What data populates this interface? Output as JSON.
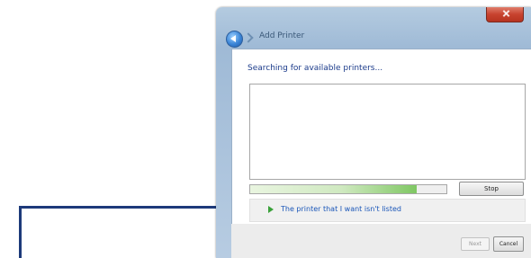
{
  "window": {
    "title": "Add Printer"
  },
  "content": {
    "heading": "Searching for available printers...",
    "progress": 0.85,
    "stop_label": "Stop",
    "not_listed_link": "The printer that I want isn't listed"
  },
  "footer": {
    "next_label": "Next",
    "cancel_label": "Cancel"
  },
  "colors": {
    "callout_arrow": "#1d3a7a",
    "heading_text": "#1a3a8a",
    "link_text": "#1a56b8",
    "progress_green": "#7fc763"
  },
  "icons": {
    "back": "back-arrow-icon",
    "forward": "forward-arrow-icon",
    "close": "close-icon",
    "link_arrow": "green-arrow-icon"
  }
}
